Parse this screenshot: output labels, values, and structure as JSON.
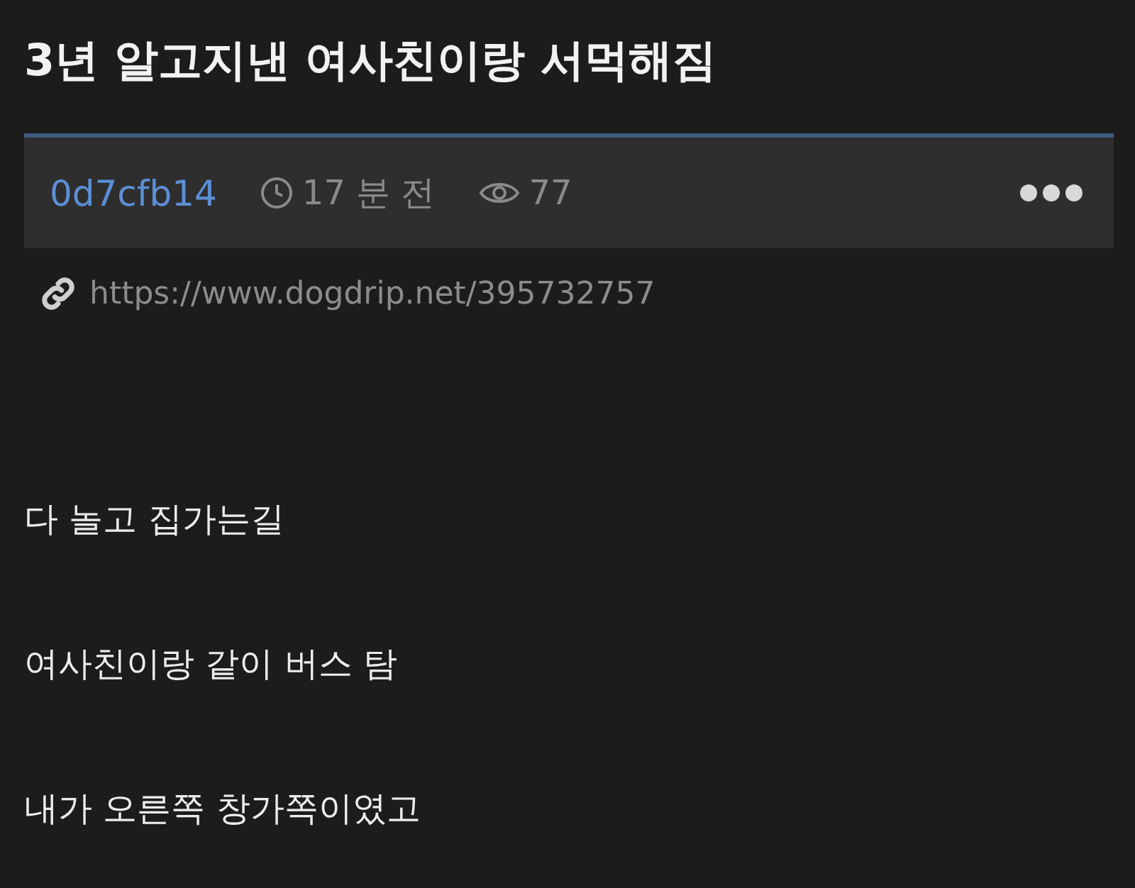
{
  "post": {
    "title": "3년 알고지낸 여사친이랑 서먹해짐",
    "author": "0d7cfb14",
    "time": "17 분 전",
    "views": "77",
    "link": "https://www.dogdrip.net/395732757",
    "paragraphs": [
      "다 놀고 집가는길",
      "여사친이랑 같이 버스 탐",
      "내가 오른쪽 창가쪽이였고"
    ]
  }
}
